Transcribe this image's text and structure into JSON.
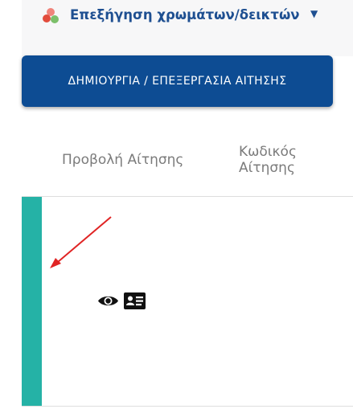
{
  "legend": {
    "title": "Επεξήγηση χρωμάτων/δεικτών",
    "icon": "color-dots-icon",
    "caret": "▼"
  },
  "create_button": {
    "label": "ΔΗΜΙΟΥΡΓΙΑ / ΕΠΕΞΕΡΓΑΣΙΑ ΑΙΤΗΣΗΣ"
  },
  "table": {
    "columns": [
      "Προβολή Αίτησης",
      "Κωδικός Αίτησης"
    ],
    "rows": [
      {
        "status_color": "#25b2a6",
        "icons": [
          "eye-icon",
          "id-card-icon"
        ],
        "code": ""
      }
    ]
  },
  "colors": {
    "brand_blue": "#0d4c93",
    "title_blue": "#1e4f91",
    "status_teal": "#25b2a6",
    "annotation_red": "#e02424"
  }
}
